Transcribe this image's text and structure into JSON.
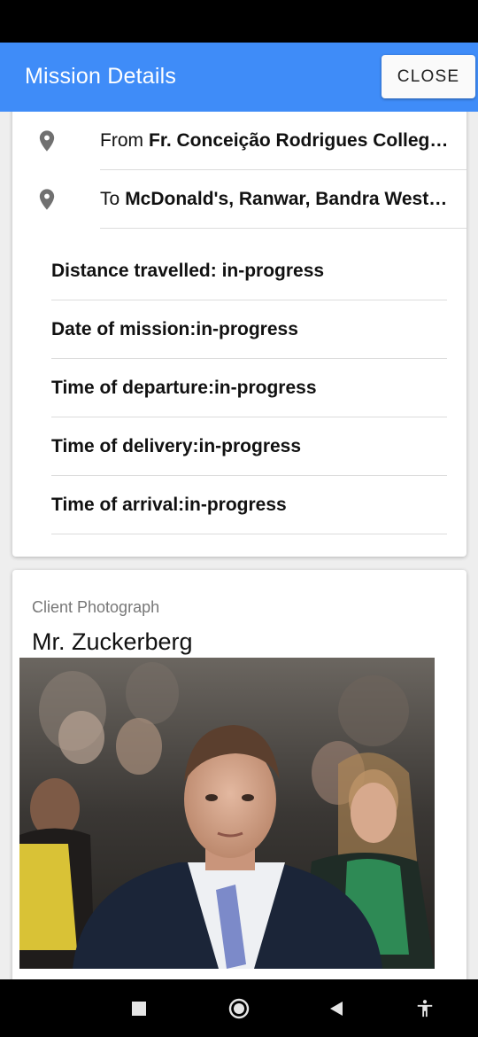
{
  "app_bar": {
    "title": "Mission Details",
    "close_label": "CLOSE",
    "color": "#3f8cf8"
  },
  "route": {
    "from_label": "From",
    "from_place": "Fr. Conceição Rodrigues College...",
    "to_label": "To",
    "to_place": "McDonald's, Ranwar, Bandra West, ...",
    "icon": "location-pin-icon"
  },
  "details": [
    "Distance travelled: in-progress",
    "Date of mission:in-progress",
    "Time of departure:in-progress",
    "Time of delivery:in-progress",
    "Time of arrival:in-progress"
  ],
  "client": {
    "caption": "Client Photograph",
    "name": "Mr. Zuckerberg",
    "photo": "client-photo"
  },
  "nav_bar": {
    "icons": [
      "recents-square-icon",
      "home-circle-icon",
      "back-triangle-icon",
      "accessibility-icon"
    ]
  }
}
